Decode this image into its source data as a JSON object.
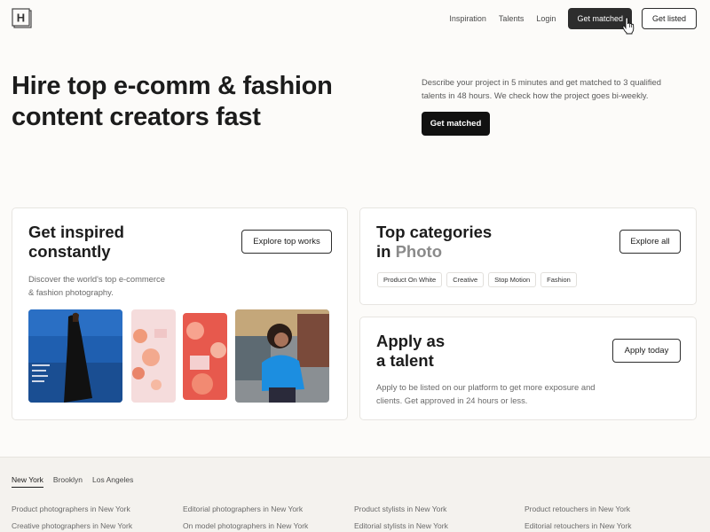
{
  "header": {
    "logo_letter": "H",
    "nav": [
      "Inspiration",
      "Talents",
      "Login"
    ],
    "primary_cta": "Get matched",
    "secondary_cta": "Get listed"
  },
  "hero": {
    "title_line1": "Hire top e-comm & fashion",
    "title_line2": "content creators fast",
    "description": "Describe your project in 5 minutes and get matched to 3 qualified talents in 48 hours. We check how the project goes bi-weekly.",
    "cta": "Get matched"
  },
  "inspired": {
    "title_line1": "Get inspired",
    "title_line2": "constantly",
    "button": "Explore top works",
    "description_line1": "Discover the world's top e-commerce",
    "description_line2": "& fashion photography."
  },
  "categories": {
    "title_line1": "Top categories",
    "title_prefix": "in",
    "title_highlight": "Photo",
    "button": "Explore all",
    "chips": [
      "Product On White",
      "Creative",
      "Stop Motion",
      "Fashion"
    ]
  },
  "apply": {
    "title_line1": "Apply as",
    "title_line2": "a talent",
    "button": "Apply today",
    "description": "Apply to be listed on our platform to get more exposure and clients. Get approved in 24 hours or less."
  },
  "footer": {
    "cities": [
      "New York",
      "Brooklyn",
      "Los Angeles"
    ],
    "active_city": "New York",
    "columns": [
      [
        "Product photographers in New York",
        "Creative photographers in New York"
      ],
      [
        "Editorial photographers in New York",
        "On model photographers in New York"
      ],
      [
        "Product stylists in New York",
        "Editorial stylists in New York"
      ],
      [
        "Product retouchers in New York",
        "Editorial retouchers in New York"
      ]
    ]
  },
  "colors": {
    "background": "#fcfbf9",
    "primary_button": "#2d2d2d",
    "text": "#1c1c1c",
    "footer_bg": "#f4f2ee"
  }
}
